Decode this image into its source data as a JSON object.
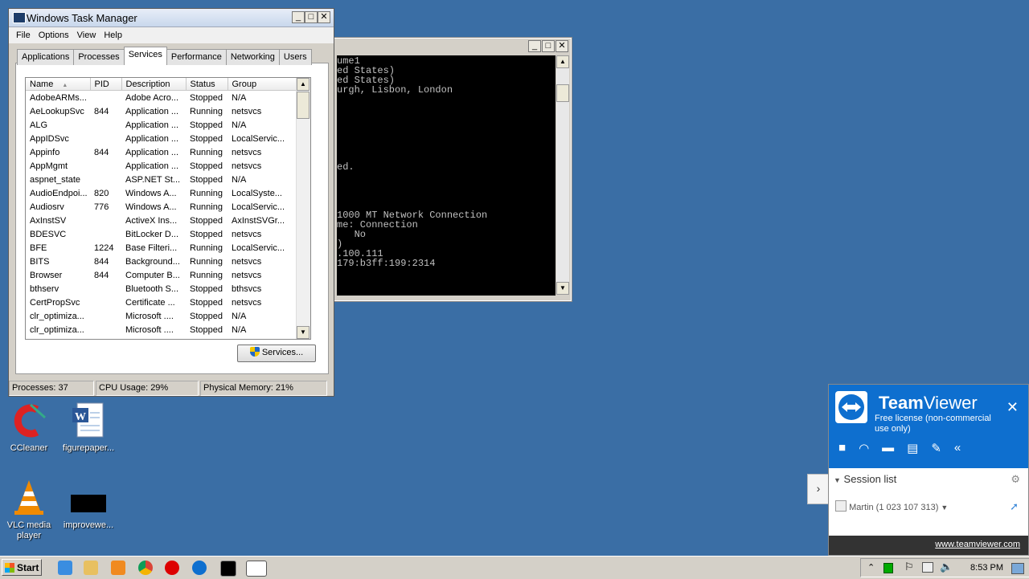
{
  "desktop": {
    "icons": [
      {
        "label": "CCleaner"
      },
      {
        "label": "figurepaper...",
        "sub": ""
      },
      {
        "label": "VLC media player"
      },
      {
        "label": "improvewe..."
      }
    ]
  },
  "console": {
    "lines": [
      "ume1",
      "ed States)",
      "ed States)",
      "urgh, Lisbon, London",
      "",
      "",
      "",
      "",
      "",
      "",
      "",
      "ed.",
      "",
      "",
      "",
      "",
      "1000 MT Network Connection",
      "me: Connection",
      "   No",
      ")",
      ".100.111",
      "179:b3ff:199:2314"
    ]
  },
  "task_manager": {
    "title": "Windows Task Manager",
    "menu": [
      "File",
      "Options",
      "View",
      "Help"
    ],
    "tabs": [
      "Applications",
      "Processes",
      "Services",
      "Performance",
      "Networking",
      "Users"
    ],
    "active_tab": "Services",
    "columns": [
      "Name",
      "PID",
      "Description",
      "Status",
      "Group"
    ],
    "rows": [
      [
        "AdobeARMs...",
        "",
        "Adobe Acro...",
        "Stopped",
        "N/A"
      ],
      [
        "AeLookupSvc",
        "844",
        "Application ...",
        "Running",
        "netsvcs"
      ],
      [
        "ALG",
        "",
        "Application ...",
        "Stopped",
        "N/A"
      ],
      [
        "AppIDSvc",
        "",
        "Application ...",
        "Stopped",
        "LocalServic..."
      ],
      [
        "Appinfo",
        "844",
        "Application ...",
        "Running",
        "netsvcs"
      ],
      [
        "AppMgmt",
        "",
        "Application ...",
        "Stopped",
        "netsvcs"
      ],
      [
        "aspnet_state",
        "",
        "ASP.NET St...",
        "Stopped",
        "N/A"
      ],
      [
        "AudioEndpoi...",
        "820",
        "Windows A...",
        "Running",
        "LocalSyste..."
      ],
      [
        "Audiosrv",
        "776",
        "Windows A...",
        "Running",
        "LocalServic..."
      ],
      [
        "AxInstSV",
        "",
        "ActiveX Ins...",
        "Stopped",
        "AxInstSVGr..."
      ],
      [
        "BDESVC",
        "",
        "BitLocker D...",
        "Stopped",
        "netsvcs"
      ],
      [
        "BFE",
        "1224",
        "Base Filteri...",
        "Running",
        "LocalServic..."
      ],
      [
        "BITS",
        "844",
        "Background...",
        "Running",
        "netsvcs"
      ],
      [
        "Browser",
        "844",
        "Computer B...",
        "Running",
        "netsvcs"
      ],
      [
        "bthserv",
        "",
        "Bluetooth S...",
        "Stopped",
        "bthsvcs"
      ],
      [
        "CertPropSvc",
        "",
        "Certificate ...",
        "Stopped",
        "netsvcs"
      ],
      [
        "clr_optimiza...",
        "",
        "Microsoft ....",
        "Stopped",
        "N/A"
      ],
      [
        "clr_optimiza...",
        "",
        "Microsoft ....",
        "Stopped",
        "N/A"
      ]
    ],
    "services_button": "Services...",
    "status": {
      "processes": "Processes: 37",
      "cpu": "CPU Usage: 29%",
      "memory": "Physical Memory: 21%"
    }
  },
  "teamviewer": {
    "brand_bold": "Team",
    "brand_light": "Viewer",
    "license": "Free license (non-commercial use only)",
    "session_list": "Session list",
    "session_entry": "Martin (1 023 107 313)",
    "footer_link": "www.teamviewer.com"
  },
  "taskbar": {
    "start_label": "Start",
    "clock": "8:53 PM"
  }
}
